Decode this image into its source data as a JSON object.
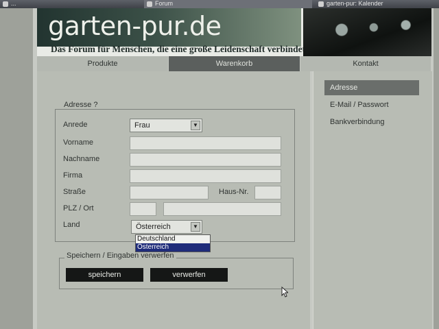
{
  "browser": {
    "tabs": [
      {
        "label": "..."
      },
      {
        "label": "Forum"
      },
      {
        "label": "garten-pur: Kalender"
      }
    ]
  },
  "header": {
    "site_title": "garten-pur.de",
    "tagline": "Das Forum für Menschen, die eine große Leidenschaft verbindet."
  },
  "nav": {
    "items": [
      {
        "label": "Produkte"
      },
      {
        "label": "Warenkorb",
        "active": true
      },
      {
        "label": "Kontakt"
      }
    ]
  },
  "address_form": {
    "legend": "Adresse   ?",
    "fields": {
      "anrede": {
        "label": "Anrede",
        "value": "Frau"
      },
      "vorname": {
        "label": "Vorname",
        "value": ""
      },
      "nachname": {
        "label": "Nachname",
        "value": ""
      },
      "firma": {
        "label": "Firma",
        "value": ""
      },
      "strasse": {
        "label": "Straße",
        "value": ""
      },
      "hausnr": {
        "label": "Haus-Nr.",
        "value": ""
      },
      "plz_ort": {
        "label": "PLZ / Ort",
        "plz": "",
        "ort": ""
      },
      "land": {
        "label": "Land",
        "value": "Österreich",
        "options": [
          "Deutschland",
          "Österreich"
        ],
        "selected_index": 1,
        "open": true
      }
    }
  },
  "actions": {
    "legend": "Speichern / Eingaben verwerfen",
    "save_label": "speichern",
    "discard_label": "verwerfen"
  },
  "sidebar": {
    "items": [
      {
        "label": "Adresse",
        "active": true
      },
      {
        "label": "E-Mail / Passwort"
      },
      {
        "label": "Bankverbindung"
      }
    ]
  },
  "colors": {
    "active_nav": "#5b5f5d",
    "button": "#151716",
    "dropdown_selected": "#1f2c7a"
  }
}
